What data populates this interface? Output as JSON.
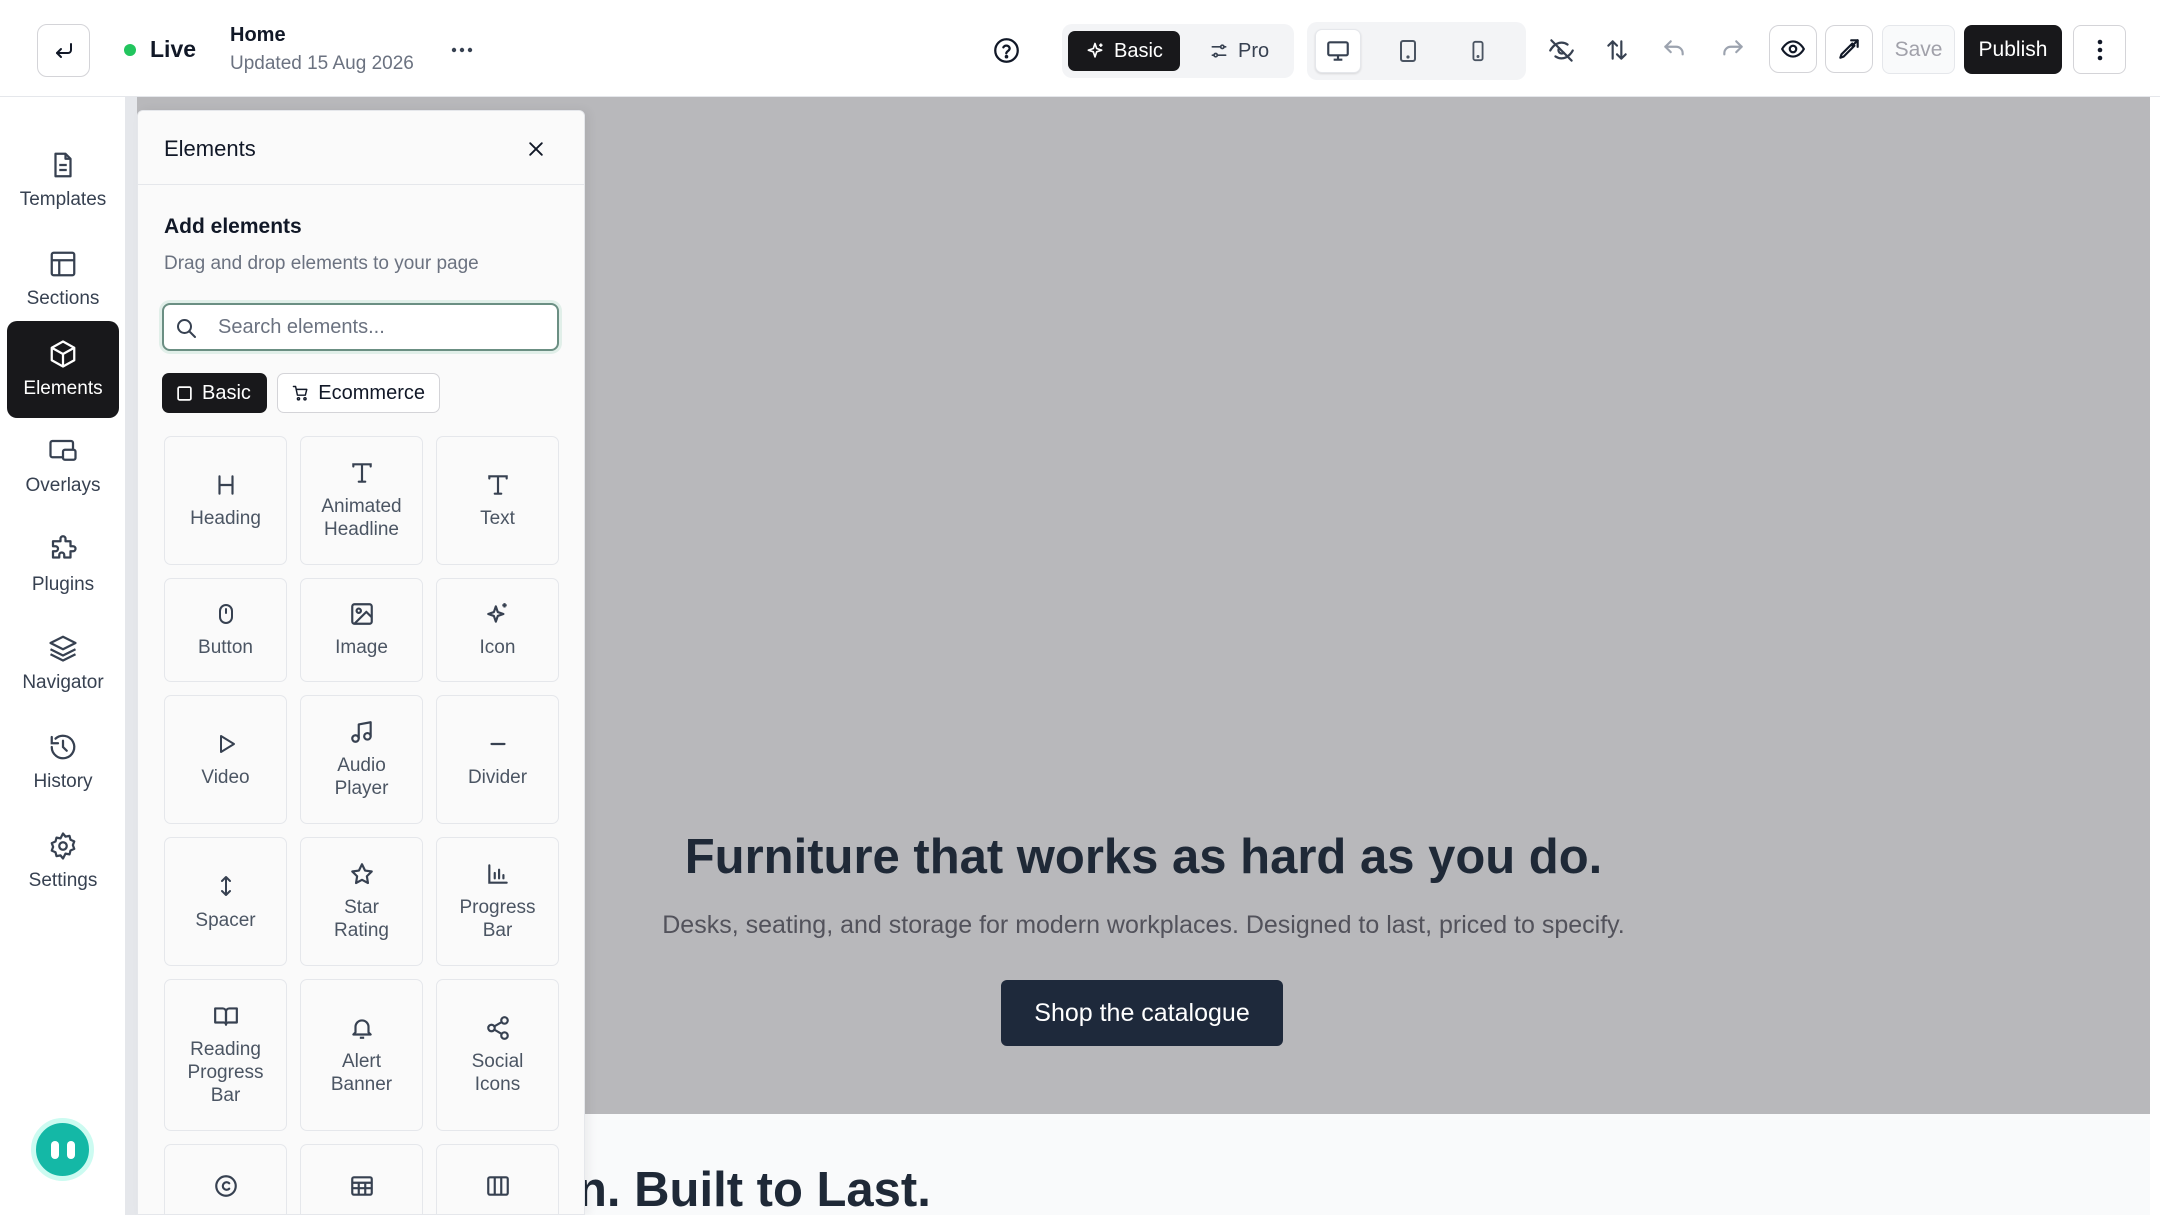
{
  "topbar": {
    "status": "Live",
    "page_title": "Home",
    "page_updated": "Updated 15 Aug 2026",
    "modes": [
      "Basic",
      "Pro"
    ],
    "save": "Save",
    "publish": "Publish"
  },
  "rail": {
    "items": [
      {
        "label": "Templates",
        "icon": "file-icon"
      },
      {
        "label": "Sections",
        "icon": "layout-icon"
      },
      {
        "label": "Elements",
        "icon": "cube-icon"
      },
      {
        "label": "Overlays",
        "icon": "overlay-icon"
      },
      {
        "label": "Plugins",
        "icon": "puzzle-icon"
      },
      {
        "label": "Navigator",
        "icon": "layers-icon"
      },
      {
        "label": "History",
        "icon": "history-icon"
      },
      {
        "label": "Settings",
        "icon": "gear-icon"
      }
    ],
    "active": "Elements"
  },
  "panel": {
    "title": "Elements",
    "add_title": "Add elements",
    "add_sub": "Drag and drop elements to your page",
    "search_placeholder": "Search elements...",
    "categories": [
      "Basic",
      "Ecommerce"
    ],
    "tiles": [
      {
        "label": "Heading",
        "icon": "heading-icon"
      },
      {
        "label": "Animated\nHeadline",
        "icon": "text-icon"
      },
      {
        "label": "Text",
        "icon": "text-icon"
      },
      {
        "label": "Button",
        "icon": "mouse-icon"
      },
      {
        "label": "Image",
        "icon": "image-icon"
      },
      {
        "label": "Icon",
        "icon": "sparkle-icon"
      },
      {
        "label": "Video",
        "icon": "play-icon"
      },
      {
        "label": "Audio\nPlayer",
        "icon": "music-icon"
      },
      {
        "label": "Divider",
        "icon": "minus-icon"
      },
      {
        "label": "Spacer",
        "icon": "vertical-arrows-icon"
      },
      {
        "label": "Star\nRating",
        "icon": "star-icon"
      },
      {
        "label": "Progress\nBar",
        "icon": "bar-chart-icon"
      },
      {
        "label": "Reading\nProgress\nBar",
        "icon": "book-icon"
      },
      {
        "label": "Alert\nBanner",
        "icon": "bell-icon"
      },
      {
        "label": "Social\nIcons",
        "icon": "share-icon"
      },
      {
        "label": "",
        "icon": "copyright-icon"
      },
      {
        "label": "",
        "icon": "table-icon"
      },
      {
        "label": "",
        "icon": "columns-icon"
      }
    ]
  },
  "canvas": {
    "hero_title": "Furniture that works as hard as you do.",
    "hero_sub": "Desks, seating, and storage for modern workplaces. Designed to last, priced to specify.",
    "hero_cta": "Shop the catalogue",
    "lower_title": "n. Built to Last."
  },
  "colors": {
    "accent_dark": "#18181b",
    "live_green": "#22c55e",
    "hero_bg": "#b8b8bb",
    "cta_bg": "#1e293b",
    "assistant": "#14b8a6"
  }
}
